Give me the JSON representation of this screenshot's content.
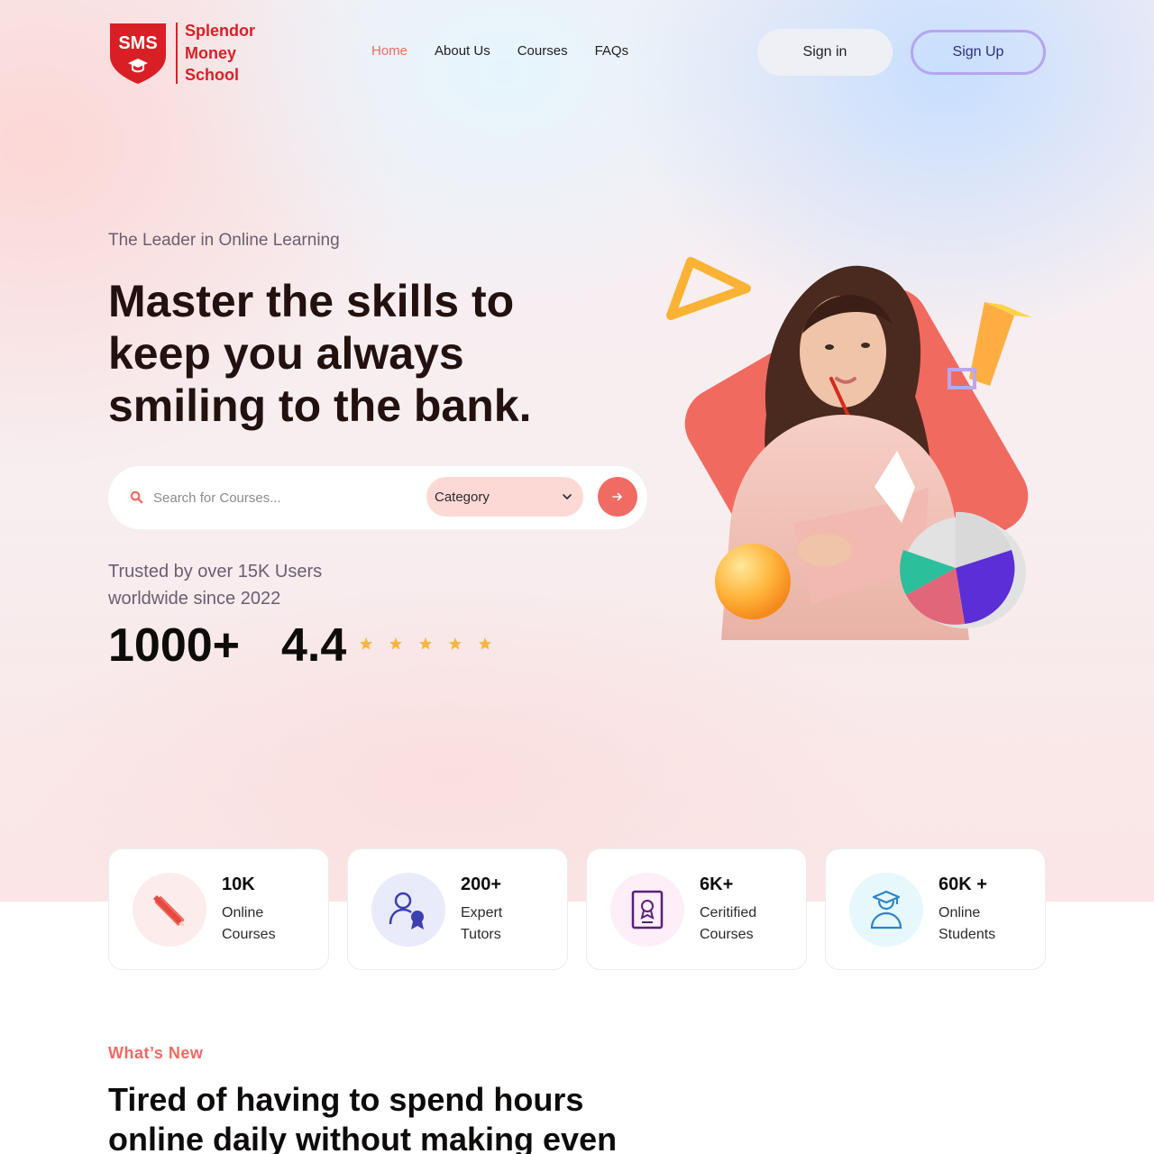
{
  "brand": {
    "logo_initials": "SMS",
    "name_line1": "Splendor",
    "name_line2": "Money",
    "name_line3": "School",
    "color": "#d91f26"
  },
  "nav": {
    "items": [
      {
        "label": "Home",
        "active": true
      },
      {
        "label": "About Us",
        "active": false
      },
      {
        "label": "Courses",
        "active": false
      },
      {
        "label": "FAQs",
        "active": false
      }
    ]
  },
  "auth": {
    "signin_label": "Sign in",
    "signup_label": "Sign Up"
  },
  "hero": {
    "tagline": "The Leader in Online Learning",
    "headline_line1": "Master the skills to",
    "headline_line2": "keep you always",
    "headline_line3": "smiling to the bank.",
    "search": {
      "placeholder": "Search for Courses...",
      "icon": "search-icon",
      "category_label": "Category",
      "go_icon": "arrow-right-icon"
    },
    "trusted_line1": "Trusted by over 15K Users",
    "trusted_line2": "worldwide since 2022",
    "count_stat": "1000+",
    "rating_stat": "4.4",
    "rating_stars": 5
  },
  "stats": [
    {
      "value": "10K",
      "label_line1": "Online",
      "label_line2": "Courses",
      "icon": "pencil-ruler-icon",
      "tint": "#fdecec"
    },
    {
      "value": "200+",
      "label_line1": "Expert",
      "label_line2": "Tutors",
      "icon": "tutor-badge-icon",
      "tint": "#e9ebfb"
    },
    {
      "value": "6K+",
      "label_line1": "Ceritified",
      "label_line2": "Courses",
      "icon": "certificate-icon",
      "tint": "#fdeef7"
    },
    {
      "value": "60K +",
      "label_line1": "Online",
      "label_line2": "Students",
      "icon": "graduate-icon",
      "tint": "#e6f8fc"
    }
  ],
  "whats_new": {
    "eyebrow": "What’s New",
    "title_line1": "Tired of having to spend hours",
    "title_line2": "online daily without making even"
  },
  "colors": {
    "accent": "#ef6b63",
    "signup_border": "#b6a5f0",
    "star": "#f7b544"
  }
}
